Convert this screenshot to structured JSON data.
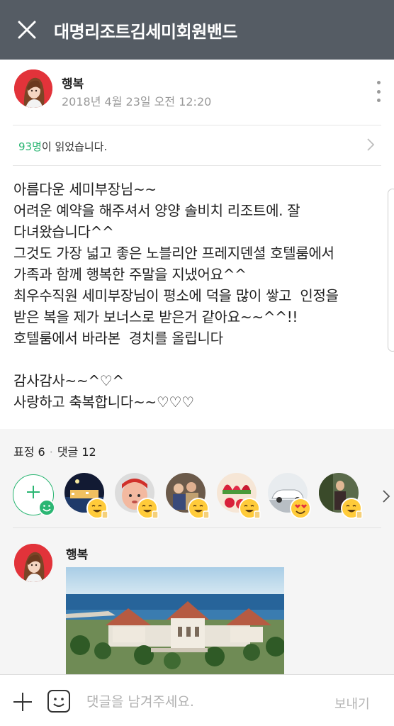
{
  "header": {
    "title": "대명리조트김세미회원밴드",
    "close_icon": "close-icon"
  },
  "post": {
    "author": "행복",
    "date": "2018년 4월 23일 오전 12:20",
    "readers_count": "93명",
    "readers_suffix": "이 읽었습니다.",
    "body": "아름다운 세미부장님~~\n어려운 예약을 해주셔서 양양 솔비치 리조트에. 잘\n다녀왔습니다^^\n그것도 가장 넓고 좋은 노블리안 프레지덴셜 호텔룸에서\n가족과 함께 행복한 주말을 지냈어요^^\n최우수직원 세미부장님이 평소에 덕을 많이 쌓고  인정을\n받은 복을 제가 보너스로 받은거 같아요~~^^!!\n호텔룸에서 바라본  경치를 올립니다\n\n감사감사~~^♡^\n사랑하고 축복합니다~~♡♡♡"
  },
  "reactions": {
    "emotion_label": "표정 6",
    "comment_label": "댓글 12",
    "reactors": [
      {
        "photo": "night-resort",
        "emoji": "smile-thumbs-icon"
      },
      {
        "photo": "baby",
        "emoji": "smile-thumbs-icon"
      },
      {
        "photo": "family",
        "emoji": "smile-thumbs-icon"
      },
      {
        "photo": "strawberries",
        "emoji": "smile-thumbs-icon"
      },
      {
        "photo": "white-car",
        "emoji": "heart-eyes-icon"
      },
      {
        "photo": "person-outdoor",
        "emoji": "smile-thumbs-icon"
      }
    ]
  },
  "comment": {
    "author": "행복",
    "photo": "resort-seaview"
  },
  "bottom_bar": {
    "placeholder": "댓글을 남겨주세요.",
    "send_label": "보내기"
  },
  "colors": {
    "header_bg": "#555c64",
    "accent_green": "#2bb673",
    "avatar_red": "#e2333a",
    "emoji_yellow": "#ffcb3a"
  }
}
